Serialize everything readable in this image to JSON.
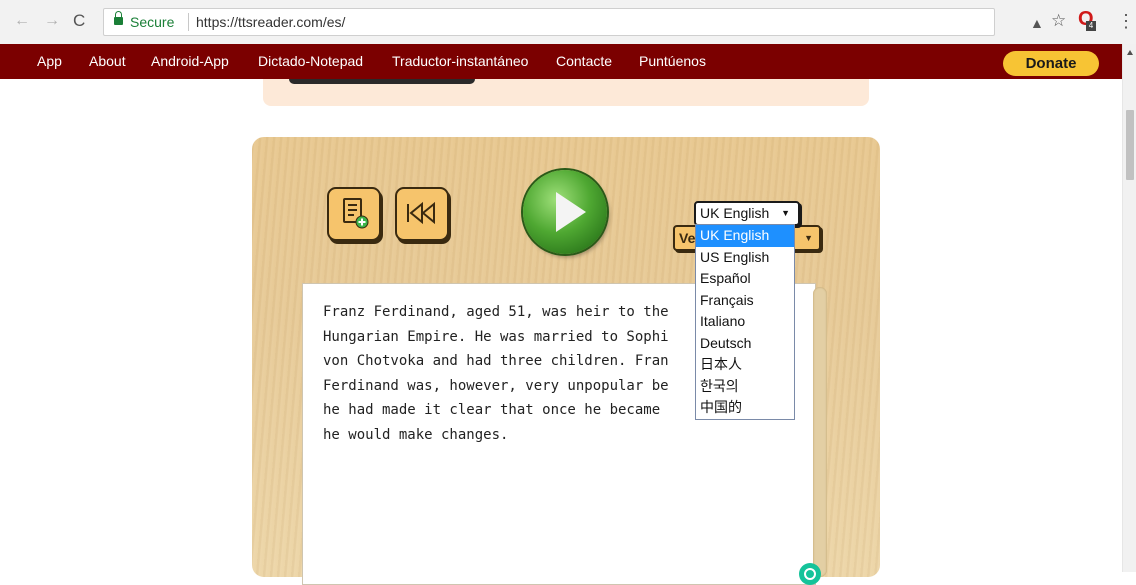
{
  "browser": {
    "back_icon": "←",
    "forward_icon": "→",
    "reload_icon": "C",
    "secure_label": "Secure",
    "url": "https://ttsreader.com/es/",
    "star_icon": "☆",
    "menu_icon": "⋮",
    "ext_badge": "4"
  },
  "nav": {
    "items": [
      "App",
      "About",
      "Android-App",
      "Dictado-Notepad",
      "Traductor-instantáneo",
      "Contacte",
      "Puntúenos"
    ],
    "donate_label": "Donate",
    "bar_color": "#7b0000",
    "donate_color": "#f7c434"
  },
  "player": {
    "voice_label": "Ve",
    "language": {
      "selected": "UK English",
      "options": [
        "UK English",
        "US English",
        "Español",
        "Français",
        "Italiano",
        "Deutsch",
        "日本人",
        "한국의",
        "中国的"
      ]
    }
  },
  "editor": {
    "text": "Franz Ferdinand, aged 51, was heir to the\nHungarian Empire. He was married to Sophi\nvon Chotvoka and had three children. Fran\nFerdinand was, however, very unpopular be\nhe had made it clear that once he became \nhe would make changes."
  }
}
